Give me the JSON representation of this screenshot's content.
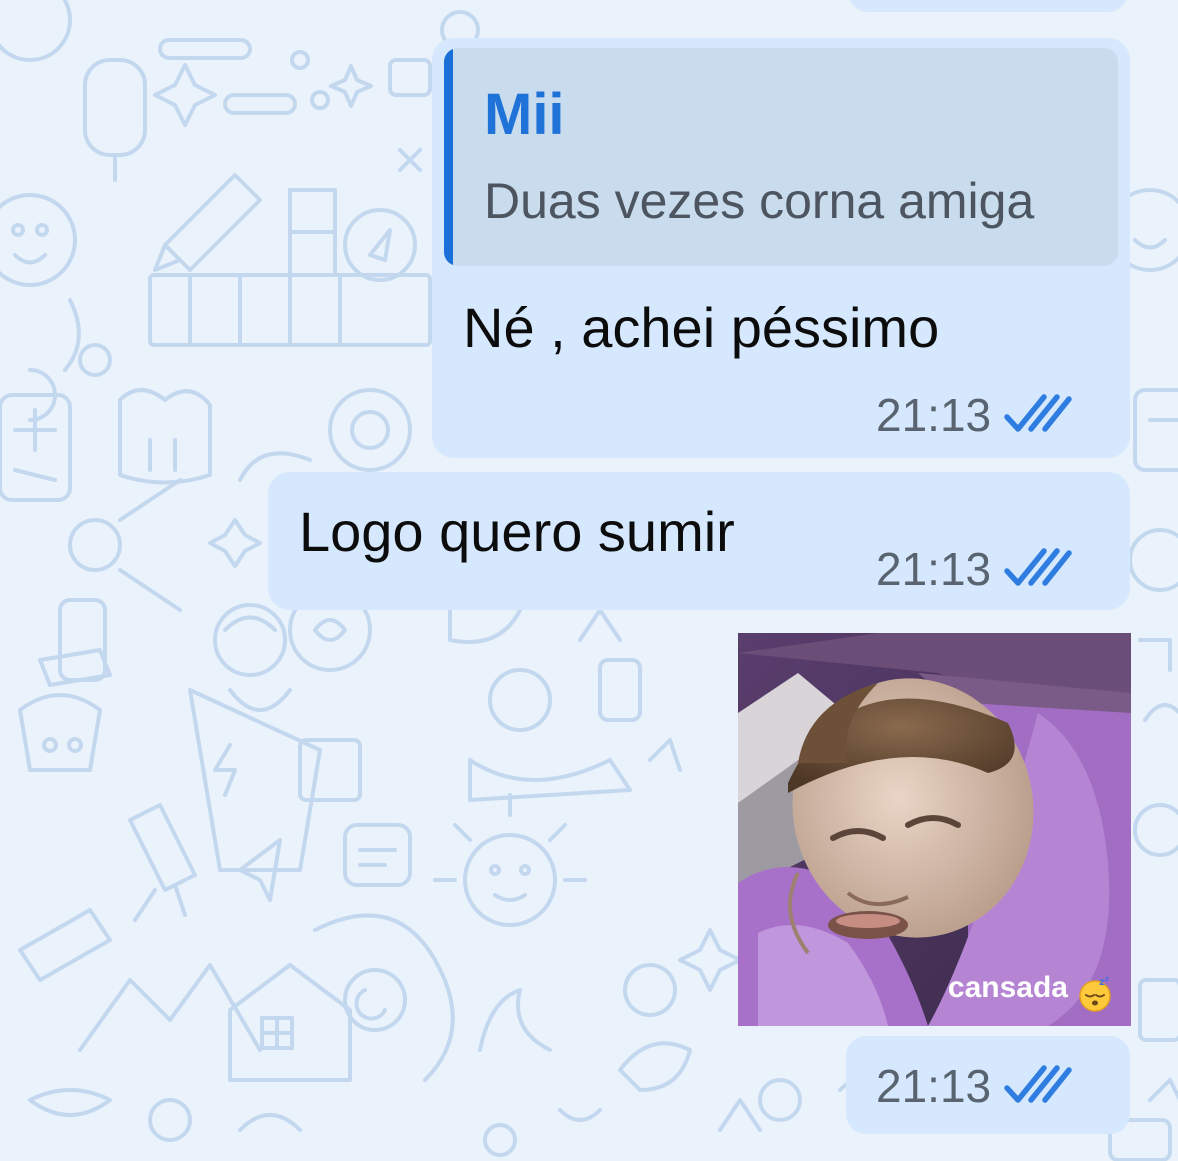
{
  "messages": [
    {
      "quote": {
        "author": "Mii",
        "text": "Duas vezes corna amiga"
      },
      "text": "Né , achei péssimo",
      "time": "21:13",
      "status": "read"
    },
    {
      "text": "Logo quero sumir",
      "time": "21:13",
      "status": "read"
    },
    {
      "sticker": {
        "caption": "cansada",
        "emoji": "sleepy-face",
        "subject": "monkey-in-purple-blanket"
      },
      "time": "21:13",
      "status": "read"
    }
  ],
  "colors": {
    "background": "#eaf2fb",
    "doodle": "#c3d8ef",
    "bubble": "#d5e8fd",
    "quote_bg": "#c9dced",
    "quote_accent": "#1a6fd8",
    "read_ticks": "#2f7de1"
  }
}
